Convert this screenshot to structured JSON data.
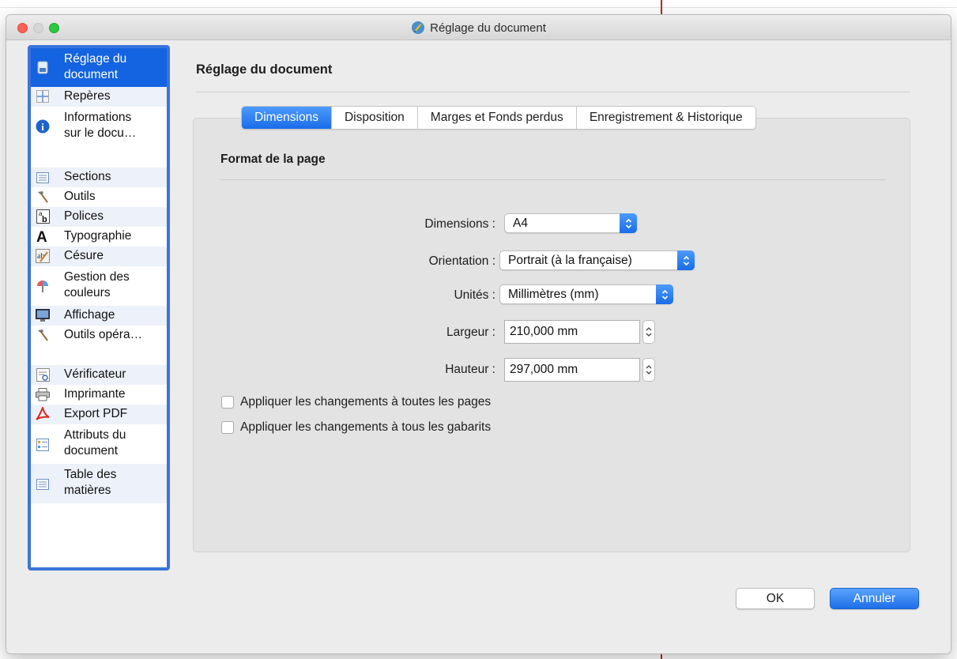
{
  "window": {
    "title": "Réglage du document"
  },
  "sidebar": {
    "items": [
      {
        "id": "reglage",
        "label": "Réglage du document",
        "lines": [
          "Réglage du",
          "document"
        ],
        "icon": "document-icon",
        "selected": true
      },
      {
        "id": "reperes",
        "label": "Repères",
        "lines": [
          "Repères"
        ],
        "icon": "guides-icon"
      },
      {
        "id": "informations",
        "label": "Informations sur le docu…",
        "lines": [
          "Informations",
          "sur le docu…"
        ],
        "icon": "info-icon"
      },
      {
        "id": "sections",
        "label": "Sections",
        "lines": [
          "Sections"
        ],
        "icon": "sections-icon"
      },
      {
        "id": "outils",
        "label": "Outils",
        "lines": [
          "Outils"
        ],
        "icon": "hammer-icon"
      },
      {
        "id": "polices",
        "label": "Polices",
        "lines": [
          "Polices"
        ],
        "icon": "fonts-icon"
      },
      {
        "id": "typographie",
        "label": "Typographie",
        "lines": [
          "Typographie"
        ],
        "icon": "typography-icon"
      },
      {
        "id": "cesure",
        "label": "Césure",
        "lines": [
          "Césure"
        ],
        "icon": "hyphenation-icon"
      },
      {
        "id": "couleurs",
        "label": "Gestion des couleurs",
        "lines": [
          "Gestion des",
          "couleurs"
        ],
        "icon": "color-management-icon"
      },
      {
        "id": "affichage",
        "label": "Affichage",
        "lines": [
          "Affichage"
        ],
        "icon": "display-icon"
      },
      {
        "id": "outils-operateur",
        "label": "Outils opéra…",
        "lines": [
          "Outils opéra…"
        ],
        "icon": "hammer-icon"
      },
      {
        "id": "verificateur",
        "label": "Vérificateur",
        "lines": [
          "Vérificateur"
        ],
        "icon": "preflight-icon"
      },
      {
        "id": "imprimante",
        "label": "Imprimante",
        "lines": [
          "Imprimante"
        ],
        "icon": "printer-icon"
      },
      {
        "id": "export-pdf",
        "label": "Export PDF",
        "lines": [
          "Export PDF"
        ],
        "icon": "pdf-icon"
      },
      {
        "id": "attributs",
        "label": "Attributs du document",
        "lines": [
          "Attributs du",
          "document"
        ],
        "icon": "attributes-icon"
      },
      {
        "id": "table",
        "label": "Table des matières",
        "lines": [
          "Table des",
          "matières"
        ],
        "icon": "toc-icon"
      }
    ]
  },
  "main": {
    "title": "Réglage du document",
    "tabs": [
      {
        "label": "Dimensions",
        "active": true
      },
      {
        "label": "Disposition",
        "active": false
      },
      {
        "label": "Marges et Fonds perdus",
        "active": false
      },
      {
        "label": "Enregistrement & Historique",
        "active": false
      }
    ],
    "section_title": "Format de la page",
    "fields": {
      "dimensions": {
        "label": "Dimensions :",
        "value": "A4"
      },
      "orientation": {
        "label": "Orientation :",
        "value": "Portrait (à la française)"
      },
      "unites": {
        "label": "Unités :",
        "value": "Millimètres (mm)"
      },
      "largeur": {
        "label": "Largeur :",
        "value": "210,000 mm"
      },
      "hauteur": {
        "label": "Hauteur :",
        "value": "297,000 mm"
      }
    },
    "checkboxes": [
      {
        "label": "Appliquer les changements à toutes les pages",
        "checked": false
      },
      {
        "label": "Appliquer les changements à tous les gabarits",
        "checked": false
      }
    ]
  },
  "buttons": {
    "ok": "OK",
    "cancel": "Annuler"
  },
  "colors": {
    "accent": "#1463e0",
    "close": "#fc5f57",
    "maximize": "#2ac940"
  }
}
